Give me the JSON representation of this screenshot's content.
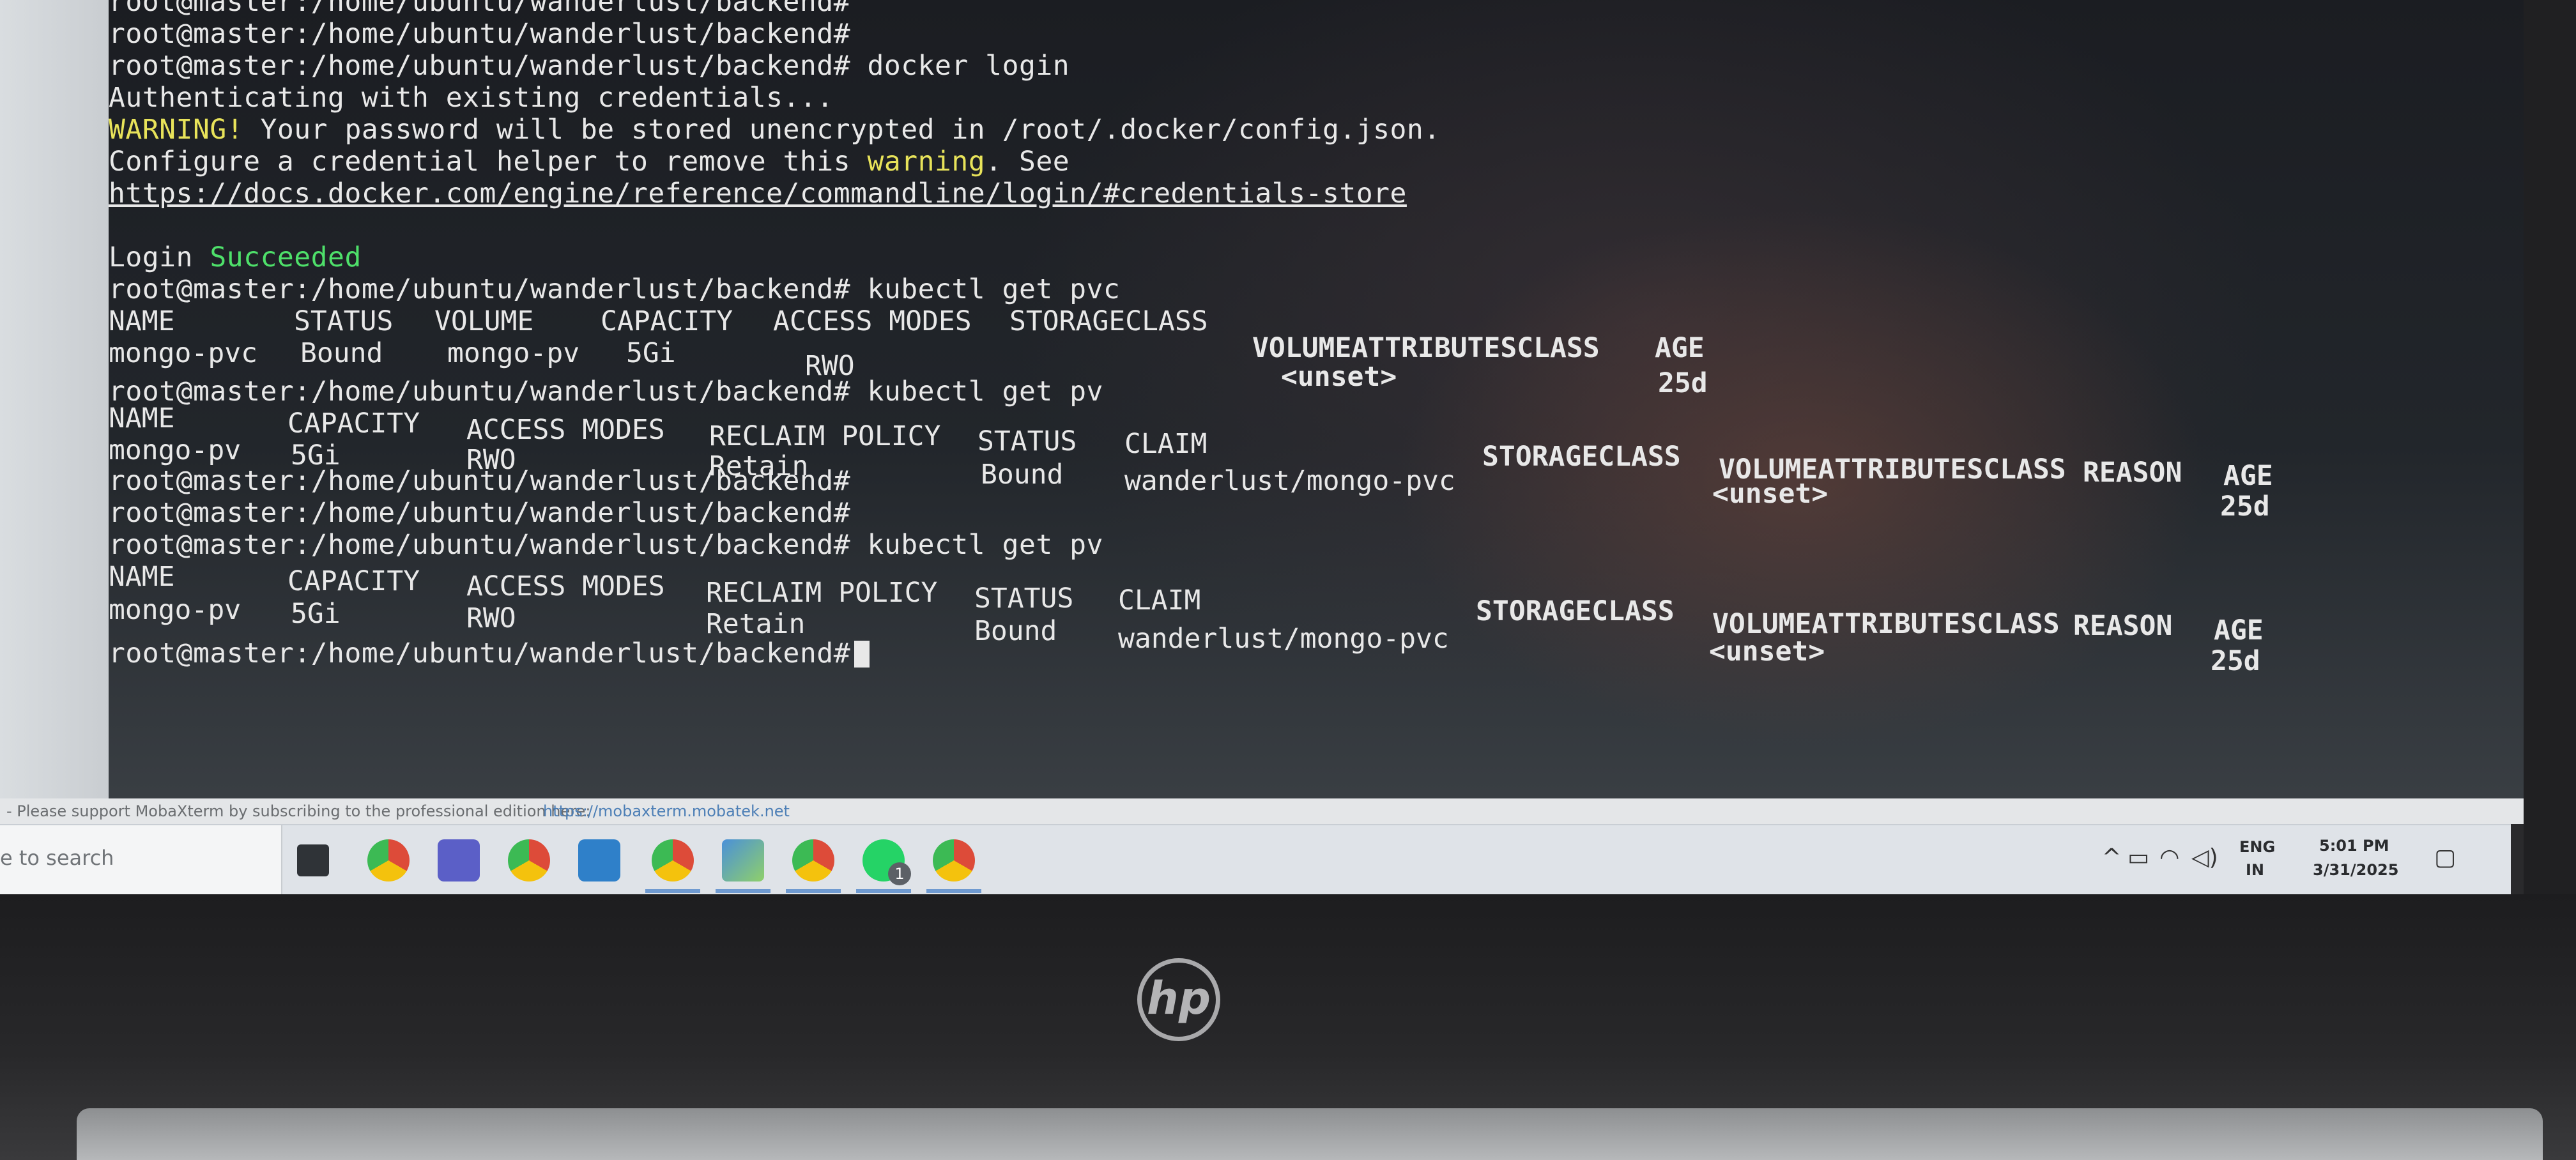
{
  "terminal": {
    "lines": [
      {
        "text": "root@master:/home/ubuntu/wanderlust/backend#"
      },
      {
        "text": "root@master:/home/ubuntu/wanderlust/backend#"
      },
      {
        "text": "root@master:/home/ubuntu/wanderlust/backend# docker login"
      },
      {
        "text": "Authenticating with existing credentials..."
      },
      {
        "warning_label": "WARNING!",
        "text": " Your password will be stored unencrypted in /root/.docker/config.json."
      },
      {
        "text_a": "Configure a credential helper to remove this ",
        "warning_word": "warning",
        "text_b": ". See"
      },
      {
        "link": "https://docs.docker.com/engine/reference/commandline/login/#credentials-store"
      },
      {
        "login_label": "Login ",
        "succeeded": "Succeeded"
      },
      {
        "text": "root@master:/home/ubuntu/wanderlust/backend# kubectl get pvc"
      }
    ],
    "pvc_table": {
      "headers": [
        "NAME",
        "STATUS",
        "VOLUME",
        "CAPACITY",
        "ACCESS MODES",
        "STORAGECLASS",
        "VOLUMEATTRIBUTESCLASS",
        "AGE"
      ],
      "row": {
        "name": "mongo-pvc",
        "status": "Bound",
        "volume": "mongo-pv",
        "capacity": "5Gi",
        "access": "RWO",
        "vac": "<unset>",
        "age": "25d"
      }
    },
    "cmd_get_pv_1": "root@master:/home/ubuntu/wanderlust/backend# kubectl get pv",
    "pv_table_1": {
      "headers": [
        "NAME",
        "CAPACITY",
        "ACCESS MODES",
        "RECLAIM POLICY",
        "STATUS",
        "CLAIM",
        "STORAGECLASS",
        "VOLUMEATTRIBUTESCLASS",
        "REASON",
        "AGE"
      ],
      "row": {
        "name": "mongo-pv",
        "capacity": "5Gi",
        "access": "RWO",
        "reclaim": "Retain",
        "status": "Bound",
        "claim": "wanderlust/mongo-pvc",
        "vac": "<unset>",
        "age": "25d"
      }
    },
    "prompt_a": "root@master:/home/ubuntu/wanderlust/backend#",
    "prompt_b": "root@master:/home/ubuntu/wanderlust/backend#",
    "cmd_get_pv_2": "root@master:/home/ubuntu/wanderlust/backend# kubectl get pv",
    "pv_table_2": {
      "headers": [
        "NAME",
        "CAPACITY",
        "ACCESS MODES",
        "RECLAIM POLICY",
        "STATUS",
        "CLAIM",
        "STORAGECLASS",
        "VOLUMEATTRIBUTESCLASS",
        "REASON",
        "AGE"
      ],
      "row": {
        "name": "mongo-pv",
        "capacity": "5Gi",
        "access": "RWO",
        "reclaim": "Retain",
        "status": "Bound",
        "claim": "wanderlust/mongo-pvc",
        "vac": "<unset>",
        "age": "25d"
      }
    },
    "final_prompt": "root@master:/home/ubuntu/wanderlust/backend#"
  },
  "banner": {
    "text": "- Please support MobaXterm by subscribing to the professional edition here:",
    "url": "https://mobaxterm.mobatek.net"
  },
  "taskbar": {
    "search_placeholder": "e to search",
    "icons": [
      {
        "name": "task-view-icon",
        "color": "#3b3f45"
      },
      {
        "name": "chrome-icon",
        "color": "#dd4b39"
      },
      {
        "name": "teams-icon",
        "color": "#5b5fc7"
      },
      {
        "name": "chrome-icon",
        "color": "#dd4b39"
      },
      {
        "name": "vscode-icon",
        "color": "#2f80c9"
      },
      {
        "name": "chrome-profile-icon",
        "color": "#dd4b39"
      },
      {
        "name": "photos-icon",
        "color": "#4a90d9"
      },
      {
        "name": "chrome-profile-icon",
        "color": "#dd4b39"
      },
      {
        "name": "whatsapp-icon",
        "color": "#25d366"
      },
      {
        "name": "chrome-icon",
        "color": "#dd4b39"
      }
    ],
    "whatsapp_badge": "1",
    "lang_top": "ENG",
    "lang_bottom": "IN",
    "time": "5:01 PM",
    "date": "3/31/2025"
  },
  "colors": {
    "prompt_text": "#e8e8e8",
    "success": "#4ee06a",
    "warning": "#e8e35a"
  }
}
